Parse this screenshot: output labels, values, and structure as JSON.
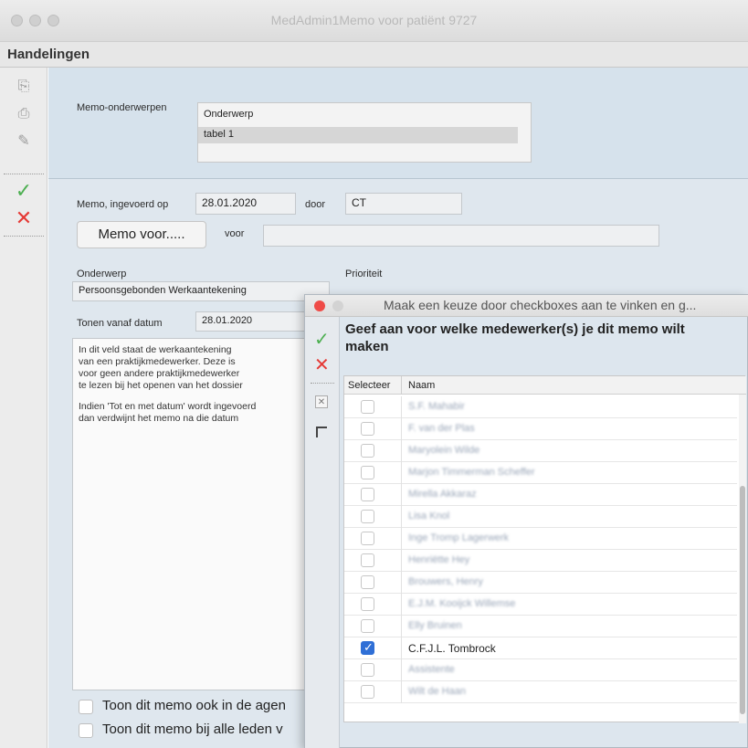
{
  "window": {
    "title": "MedAdmin1Memo voor patiënt 9727"
  },
  "menu": {
    "handelingen": "Handelingen"
  },
  "topics": {
    "label": "Memo-onderwerpen",
    "column_header": "Onderwerp",
    "items": [
      "tabel 1"
    ]
  },
  "memo": {
    "entered_label": "Memo, ingevoerd op",
    "entered_date": "28.01.2020",
    "by_label": "door",
    "by_value": "CT",
    "memo_for_button": "Memo voor.....",
    "for_label": "voor",
    "for_value": "",
    "subject_label": "Onderwerp",
    "subject_value": "Persoonsgebonden Werkaantekening",
    "priority_label": "Prioriteit",
    "show_from_label": "Tonen vanaf datum",
    "show_from_value": "28.01.2020",
    "text_lines": [
      "In dit veld staat de werkaantekening",
      "van een praktijkmedewerker. Deze is",
      "voor geen andere praktijkmedewerker",
      "te lezen bij het openen van het dossier",
      "",
      "Indien 'Tot en met datum' wordt ingevoerd",
      "dan verdwijnt het memo na die datum"
    ],
    "check_agenda_label": "Toon dit memo ook in de agen",
    "check_all_members_label": "Toon dit memo bij alle leden v"
  },
  "dialog": {
    "title": "Maak een keuze door checkboxes aan te vinken en g...",
    "question": "Geef aan voor welke medewerker(s) je dit memo wilt maken",
    "col_select": "Selecteer",
    "col_name": "Naam",
    "rows": [
      {
        "name": "S.F. Mahabir",
        "checked": false
      },
      {
        "name": "F. van der Plas",
        "checked": false
      },
      {
        "name": "Maryolein Wilde",
        "checked": false
      },
      {
        "name": "Marjon Timmerman Scheffer",
        "checked": false
      },
      {
        "name": "Mirella Akkaraz",
        "checked": false
      },
      {
        "name": "Lisa Knol",
        "checked": false
      },
      {
        "name": "Inge Tromp Lagerwerk",
        "checked": false
      },
      {
        "name": "Henriëtte Hey",
        "checked": false
      },
      {
        "name": "Brouwers, Henry",
        "checked": false
      },
      {
        "name": "E.J.M. Kooijck Willemse",
        "checked": false
      },
      {
        "name": "Elly Bruinen",
        "checked": false
      },
      {
        "name": "C.F.J.L. Tombrock",
        "checked": true
      },
      {
        "name": "Assistente",
        "checked": false
      },
      {
        "name": "Wilt de Haan",
        "checked": false
      }
    ]
  },
  "colors": {
    "accent": "#2f6fd6",
    "ok": "#4caf50",
    "cancel": "#e53935",
    "close": "#ef4b47"
  }
}
